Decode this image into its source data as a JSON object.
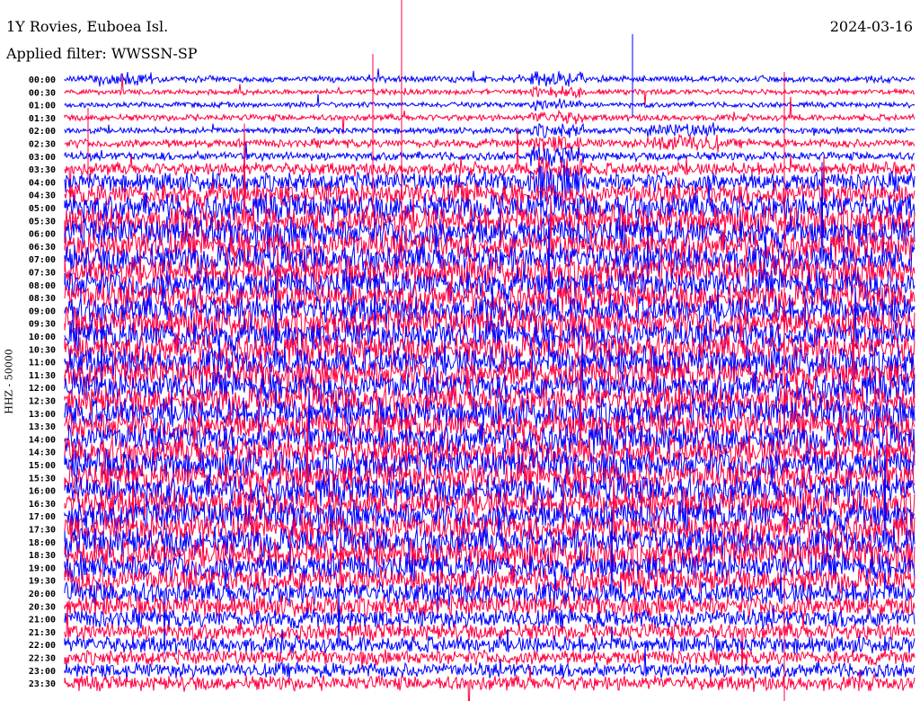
{
  "header": {
    "station": "1Y Rovies, Euboea Isl.",
    "filter": "Applied filter: WWSSN-SP",
    "date": "2024-03-16"
  },
  "colors": {
    "even": "#0000ff",
    "odd": "#ff0040"
  },
  "chart_data": {
    "type": "line",
    "title": "1Y Rovies, Euboea Isl.",
    "ylabel": "HHZ - 50000",
    "row_interval_minutes": 30,
    "row_labels": [
      "00:00",
      "00:30",
      "01:00",
      "01:30",
      "02:00",
      "02:30",
      "03:00",
      "03:30",
      "04:00",
      "04:30",
      "05:00",
      "05:30",
      "06:00",
      "06:30",
      "07:00",
      "07:30",
      "08:00",
      "08:30",
      "09:00",
      "09:30",
      "10:00",
      "10:30",
      "11:00",
      "11:30",
      "12:00",
      "12:30",
      "13:00",
      "13:30",
      "14:00",
      "14:30",
      "15:00",
      "15:30",
      "16:00",
      "16:30",
      "17:00",
      "17:30",
      "18:00",
      "18:30",
      "19:00",
      "19:30",
      "20:00",
      "20:30",
      "21:00",
      "21:30",
      "22:00",
      "22:30",
      "23:00",
      "23:30"
    ],
    "row_noise_level": [
      3,
      2.5,
      2.5,
      3,
      3,
      4,
      4,
      6,
      9,
      11,
      13,
      14,
      14,
      14,
      14,
      14,
      14,
      14,
      14,
      14,
      14,
      14,
      14,
      14,
      14,
      14,
      14,
      14,
      14,
      14,
      14,
      14,
      14,
      14,
      14,
      14,
      14,
      14,
      13,
      12,
      11,
      10,
      9,
      8,
      8,
      7,
      7,
      7
    ]
  }
}
